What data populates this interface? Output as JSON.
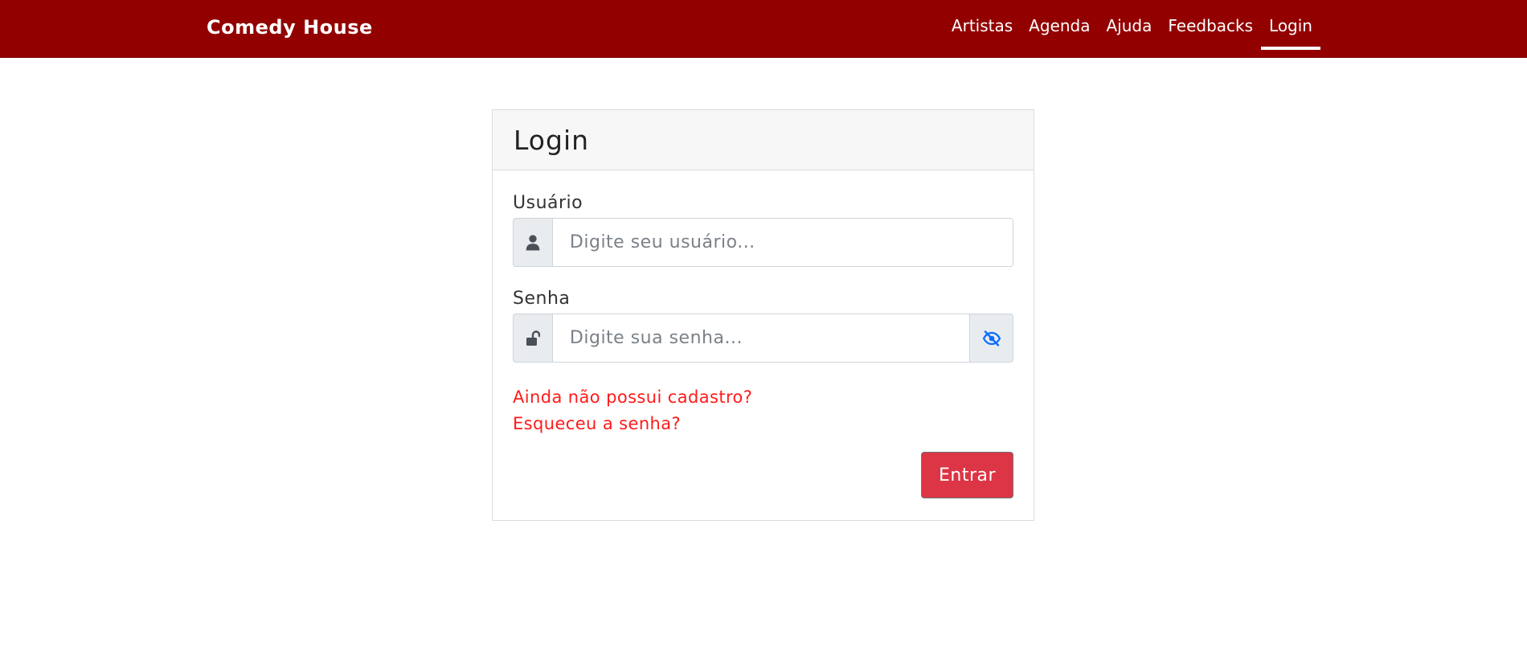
{
  "navbar": {
    "brand": "Comedy House",
    "items": [
      {
        "label": "Artistas"
      },
      {
        "label": "Agenda"
      },
      {
        "label": "Ajuda"
      },
      {
        "label": "Feedbacks"
      },
      {
        "label": "Login",
        "active": true
      }
    ],
    "background_color": "#930000"
  },
  "card": {
    "title": "Login",
    "username": {
      "label": "Usuário",
      "placeholder": "Digite seu usuário...",
      "value": "",
      "icon": "user-icon"
    },
    "password": {
      "label": "Senha",
      "placeholder": "Digite sua senha...",
      "value": "",
      "icon": "unlock-icon",
      "toggle_icon": "eye-slash-icon",
      "toggle_color": "#0d6efd"
    },
    "links": {
      "register": "Ainda não possui cadastro?",
      "forgot": "Esqueceu a senha?"
    },
    "submit_label": "Entrar",
    "submit_color": "#dc3545"
  }
}
